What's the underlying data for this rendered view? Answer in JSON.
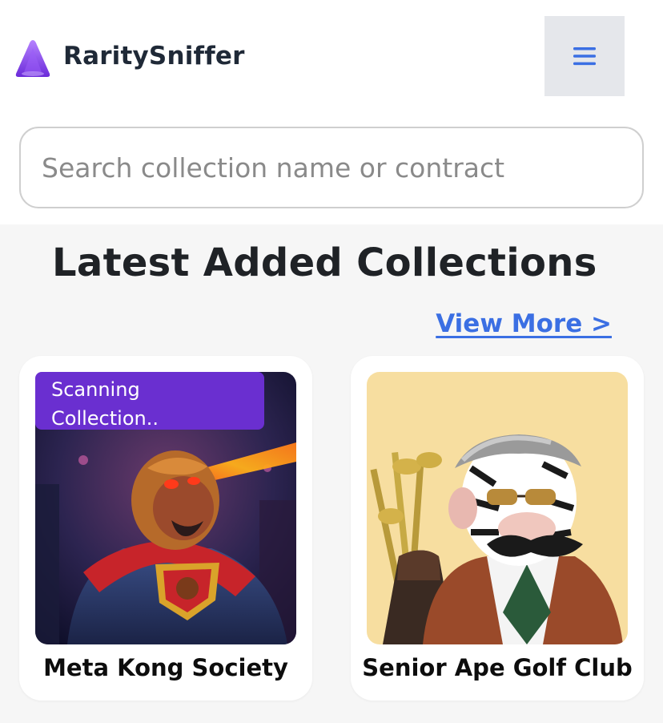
{
  "header": {
    "brand": "RaritySniffer",
    "logo_icon": "purple-triangle-logo",
    "menu_icon": "hamburger-icon",
    "accent_color": "#3b6fe3"
  },
  "search": {
    "placeholder": "Search collection name or contract",
    "value": ""
  },
  "section": {
    "title": "Latest Added Collections",
    "view_more": "View More >"
  },
  "collections": [
    {
      "name": "Meta Kong Society",
      "badge": "Scanning Collection..",
      "image": "superhero-gorilla-laser-eyes-illustration",
      "badge_color": "#6a2fd0"
    },
    {
      "name": "Senior Ape Golf Club",
      "image": "elderly-zebra-ape-golfer-illustration"
    }
  ]
}
